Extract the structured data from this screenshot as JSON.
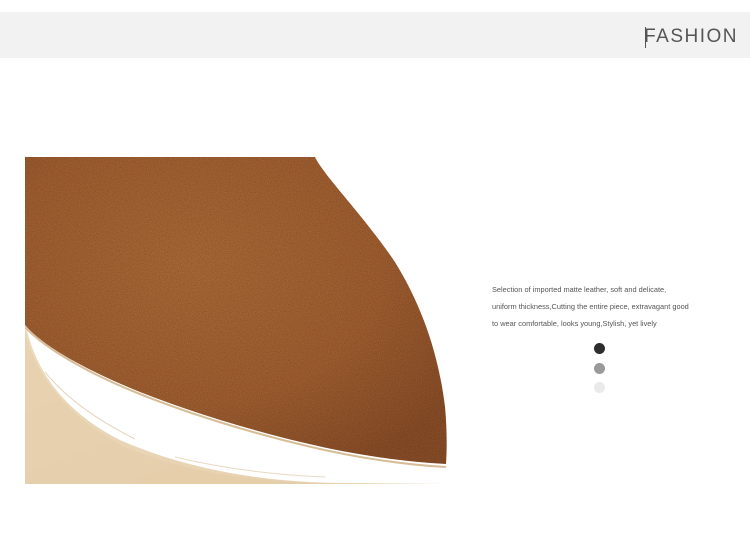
{
  "banner": {
    "title": "FASHION"
  },
  "product_photo": {
    "subject": "leather-texture",
    "colors": {
      "leather": "#b06a35",
      "sole": "#ead6b7"
    }
  },
  "description": {
    "lines": [
      "Selection of imported matte leather, soft and delicate,",
      "uniform thickness,Cutting the entire piece, extravagant good",
      "to wear comfortable, looks young,Stylish, yet lively"
    ]
  },
  "color_options": [
    {
      "color": "#2d2d2d"
    },
    {
      "color": "#9a9a9a"
    },
    {
      "color": "#eaeaea"
    }
  ]
}
